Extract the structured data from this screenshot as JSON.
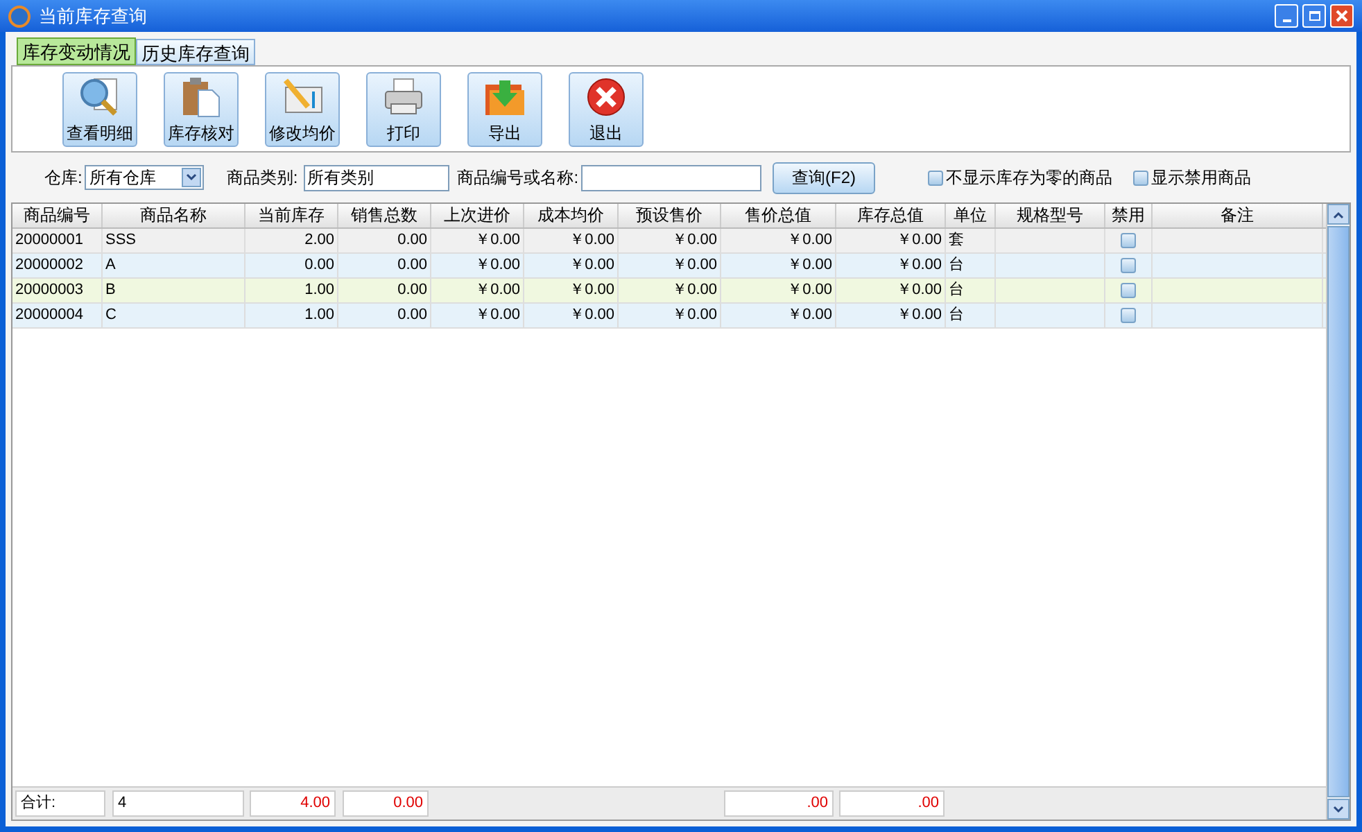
{
  "window": {
    "title": "当前库存查询"
  },
  "tabs": [
    {
      "label": "库存变动情况",
      "selected": true
    },
    {
      "label": "历史库存查询",
      "selected": false
    }
  ],
  "toolbar": [
    {
      "label": "查看明细",
      "kind": "detail"
    },
    {
      "label": "库存核对",
      "kind": "check"
    },
    {
      "label": "修改均价",
      "kind": "price"
    },
    {
      "label": "打印",
      "kind": "print"
    },
    {
      "label": "导出",
      "kind": "export"
    },
    {
      "label": "退出",
      "kind": "exit"
    }
  ],
  "filters": {
    "warehouse_label": "仓库:",
    "warehouse_value": "所有仓库",
    "category_label": "商品类别:",
    "category_value": "所有类别",
    "code_label": "商品编号或名称:",
    "query_button": "查询(F2)",
    "options": [
      {
        "label": "不显示库存为零的商品",
        "checked": false
      },
      {
        "label": "显示禁用商品",
        "checked": false
      }
    ]
  },
  "table": {
    "columns": [
      "商品编号",
      "商品名称",
      "当前库存",
      "销售总数",
      "上次进价",
      "成本均价",
      "预设售价",
      "售价总值",
      "库存总值",
      "单位",
      "规格型号",
      "禁用",
      "备注"
    ],
    "rows": [
      {
        "cells": [
          "20000001",
          "SSS",
          "2.00",
          "0.00",
          "￥0.00",
          "￥0.00",
          "￥0.00",
          "￥0.00",
          "￥0.00",
          "套"
        ],
        "disabled": false,
        "selected": false
      },
      {
        "cells": [
          "20000002",
          "A",
          "0.00",
          "0.00",
          "￥0.00",
          "￥0.00",
          "￥0.00",
          "￥0.00",
          "￥0.00",
          "台"
        ],
        "disabled": false,
        "selected": false
      },
      {
        "cells": [
          "20000003",
          "B",
          "1.00",
          "0.00",
          "￥0.00",
          "￥0.00",
          "￥0.00",
          "￥0.00",
          "￥0.00",
          "台"
        ],
        "disabled": false,
        "selected": true
      },
      {
        "cells": [
          "20000004",
          "C",
          "1.00",
          "0.00",
          "￥0.00",
          "￥0.00",
          "￥0.00",
          "￥0.00",
          "￥0.00",
          "台"
        ],
        "disabled": false,
        "selected": false
      }
    ]
  },
  "totals": {
    "label": "合计:",
    "count": "4",
    "stock": "4.00",
    "sales": "0.00",
    "sale_value": ".00",
    "stock_value": ".00"
  }
}
